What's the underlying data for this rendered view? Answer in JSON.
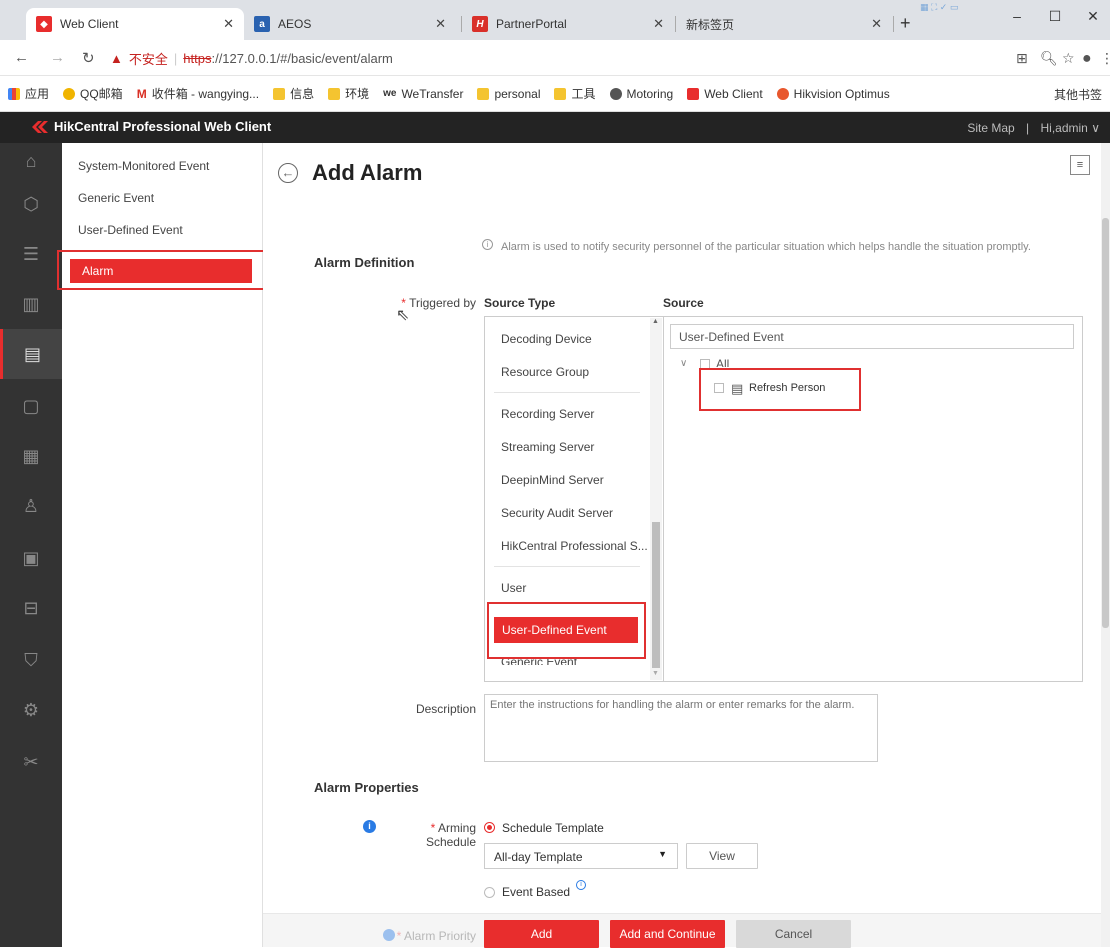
{
  "browser": {
    "tabs": [
      {
        "title": "Web Client",
        "favicon_color": "#e82d2d"
      },
      {
        "title": "AEOS",
        "favicon_text": "a",
        "favicon_color": "#2a62b0"
      },
      {
        "title": "PartnerPortal",
        "favicon_text": "H",
        "favicon_color": "#d9302a"
      },
      {
        "title": "新标签页",
        "favicon_color": ""
      }
    ],
    "url_insecure": "不安全",
    "url_https": "https",
    "url_rest": "://127.0.0.1/#/basic/event/alarm",
    "bookmarks": [
      {
        "label": "应用",
        "icon": "apps-icon"
      },
      {
        "label": "QQ邮箱",
        "icon": "qq-icon"
      },
      {
        "label": "收件箱 - wangying...",
        "icon": "gmail-icon"
      },
      {
        "label": "信息",
        "icon": "folder-icon"
      },
      {
        "label": "环境",
        "icon": "folder-icon"
      },
      {
        "label": "WeTransfer",
        "icon": "wetransfer-icon"
      },
      {
        "label": "personal",
        "icon": "folder-icon"
      },
      {
        "label": "工具",
        "icon": "folder-icon"
      },
      {
        "label": "Motoring",
        "icon": "globe-icon"
      },
      {
        "label": "Web Client",
        "icon": "hik-icon"
      },
      {
        "label": "Hikvision Optimus",
        "icon": "hik-optimus-icon"
      }
    ],
    "other_bookmarks": "其他书签"
  },
  "app": {
    "title": "HikCentral Professional Web Client",
    "site_map": "Site Map",
    "user": "Hi,admin"
  },
  "submenu": {
    "items": [
      "System-Monitored Event",
      "Generic Event",
      "User-Defined Event"
    ],
    "active": "Alarm"
  },
  "page": {
    "title": "Add Alarm",
    "info": "Alarm is used to notify security personnel of the particular situation which helps handle the situation promptly.",
    "definition_title": "Alarm Definition",
    "triggered_by": "Triggered by",
    "source_type_header": "Source Type",
    "source_header": "Source",
    "source_types": [
      "Decoding Device",
      "Resource Group",
      "Recording Server",
      "Streaming Server",
      "DeepinMind Server",
      "Security Audit Server",
      "HikCentral Professional S...",
      "User",
      "User-Defined Event",
      "Generic Event"
    ],
    "selected_source_type": "User-Defined Event",
    "source_search_value": "User-Defined Event",
    "tree_all": "All",
    "tree_child": "Refresh Person",
    "description_label": "Description",
    "description_placeholder": "Enter the instructions for handling the alarm or enter remarks for the alarm.",
    "properties_title": "Alarm Properties",
    "arming_schedule": "Arming Schedule",
    "schedule_template": "Schedule Template",
    "template_value": "All-day Template",
    "view": "View",
    "event_based": "Event Based",
    "alarm_priority": "Alarm Priority",
    "add": "Add",
    "add_continue": "Add and Continue",
    "cancel": "Cancel"
  },
  "colors": {
    "accent": "#e82d2d",
    "dark": "#232323",
    "rail": "#333333"
  }
}
